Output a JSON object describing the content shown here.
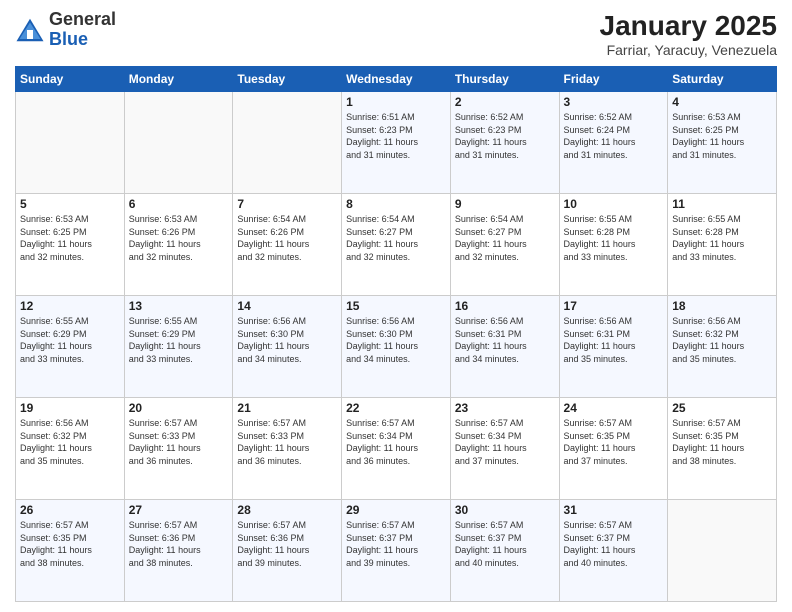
{
  "header": {
    "logo": {
      "line1": "General",
      "line2": "Blue"
    },
    "title": "January 2025",
    "location": "Farriar, Yaracuy, Venezuela"
  },
  "weekdays": [
    "Sunday",
    "Monday",
    "Tuesday",
    "Wednesday",
    "Thursday",
    "Friday",
    "Saturday"
  ],
  "weeks": [
    [
      {
        "day": "",
        "info": ""
      },
      {
        "day": "",
        "info": ""
      },
      {
        "day": "",
        "info": ""
      },
      {
        "day": "1",
        "info": "Sunrise: 6:51 AM\nSunset: 6:23 PM\nDaylight: 11 hours\nand 31 minutes."
      },
      {
        "day": "2",
        "info": "Sunrise: 6:52 AM\nSunset: 6:23 PM\nDaylight: 11 hours\nand 31 minutes."
      },
      {
        "day": "3",
        "info": "Sunrise: 6:52 AM\nSunset: 6:24 PM\nDaylight: 11 hours\nand 31 minutes."
      },
      {
        "day": "4",
        "info": "Sunrise: 6:53 AM\nSunset: 6:25 PM\nDaylight: 11 hours\nand 31 minutes."
      }
    ],
    [
      {
        "day": "5",
        "info": "Sunrise: 6:53 AM\nSunset: 6:25 PM\nDaylight: 11 hours\nand 32 minutes."
      },
      {
        "day": "6",
        "info": "Sunrise: 6:53 AM\nSunset: 6:26 PM\nDaylight: 11 hours\nand 32 minutes."
      },
      {
        "day": "7",
        "info": "Sunrise: 6:54 AM\nSunset: 6:26 PM\nDaylight: 11 hours\nand 32 minutes."
      },
      {
        "day": "8",
        "info": "Sunrise: 6:54 AM\nSunset: 6:27 PM\nDaylight: 11 hours\nand 32 minutes."
      },
      {
        "day": "9",
        "info": "Sunrise: 6:54 AM\nSunset: 6:27 PM\nDaylight: 11 hours\nand 32 minutes."
      },
      {
        "day": "10",
        "info": "Sunrise: 6:55 AM\nSunset: 6:28 PM\nDaylight: 11 hours\nand 33 minutes."
      },
      {
        "day": "11",
        "info": "Sunrise: 6:55 AM\nSunset: 6:28 PM\nDaylight: 11 hours\nand 33 minutes."
      }
    ],
    [
      {
        "day": "12",
        "info": "Sunrise: 6:55 AM\nSunset: 6:29 PM\nDaylight: 11 hours\nand 33 minutes."
      },
      {
        "day": "13",
        "info": "Sunrise: 6:55 AM\nSunset: 6:29 PM\nDaylight: 11 hours\nand 33 minutes."
      },
      {
        "day": "14",
        "info": "Sunrise: 6:56 AM\nSunset: 6:30 PM\nDaylight: 11 hours\nand 34 minutes."
      },
      {
        "day": "15",
        "info": "Sunrise: 6:56 AM\nSunset: 6:30 PM\nDaylight: 11 hours\nand 34 minutes."
      },
      {
        "day": "16",
        "info": "Sunrise: 6:56 AM\nSunset: 6:31 PM\nDaylight: 11 hours\nand 34 minutes."
      },
      {
        "day": "17",
        "info": "Sunrise: 6:56 AM\nSunset: 6:31 PM\nDaylight: 11 hours\nand 35 minutes."
      },
      {
        "day": "18",
        "info": "Sunrise: 6:56 AM\nSunset: 6:32 PM\nDaylight: 11 hours\nand 35 minutes."
      }
    ],
    [
      {
        "day": "19",
        "info": "Sunrise: 6:56 AM\nSunset: 6:32 PM\nDaylight: 11 hours\nand 35 minutes."
      },
      {
        "day": "20",
        "info": "Sunrise: 6:57 AM\nSunset: 6:33 PM\nDaylight: 11 hours\nand 36 minutes."
      },
      {
        "day": "21",
        "info": "Sunrise: 6:57 AM\nSunset: 6:33 PM\nDaylight: 11 hours\nand 36 minutes."
      },
      {
        "day": "22",
        "info": "Sunrise: 6:57 AM\nSunset: 6:34 PM\nDaylight: 11 hours\nand 36 minutes."
      },
      {
        "day": "23",
        "info": "Sunrise: 6:57 AM\nSunset: 6:34 PM\nDaylight: 11 hours\nand 37 minutes."
      },
      {
        "day": "24",
        "info": "Sunrise: 6:57 AM\nSunset: 6:35 PM\nDaylight: 11 hours\nand 37 minutes."
      },
      {
        "day": "25",
        "info": "Sunrise: 6:57 AM\nSunset: 6:35 PM\nDaylight: 11 hours\nand 38 minutes."
      }
    ],
    [
      {
        "day": "26",
        "info": "Sunrise: 6:57 AM\nSunset: 6:35 PM\nDaylight: 11 hours\nand 38 minutes."
      },
      {
        "day": "27",
        "info": "Sunrise: 6:57 AM\nSunset: 6:36 PM\nDaylight: 11 hours\nand 38 minutes."
      },
      {
        "day": "28",
        "info": "Sunrise: 6:57 AM\nSunset: 6:36 PM\nDaylight: 11 hours\nand 39 minutes."
      },
      {
        "day": "29",
        "info": "Sunrise: 6:57 AM\nSunset: 6:37 PM\nDaylight: 11 hours\nand 39 minutes."
      },
      {
        "day": "30",
        "info": "Sunrise: 6:57 AM\nSunset: 6:37 PM\nDaylight: 11 hours\nand 40 minutes."
      },
      {
        "day": "31",
        "info": "Sunrise: 6:57 AM\nSunset: 6:37 PM\nDaylight: 11 hours\nand 40 minutes."
      },
      {
        "day": "",
        "info": ""
      }
    ]
  ]
}
